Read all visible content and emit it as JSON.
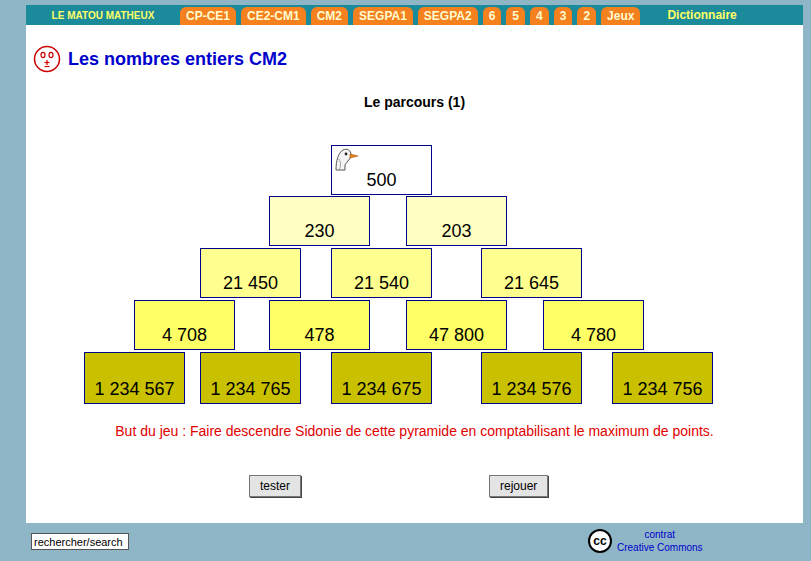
{
  "header": {
    "brand": "LE MATOU MATHEUX",
    "tabs": [
      {
        "label": "CP-CE1",
        "selected": false
      },
      {
        "label": "CE2-CM1",
        "selected": false
      },
      {
        "label": "CM2",
        "selected": false
      },
      {
        "label": "SEGPA1",
        "selected": false
      },
      {
        "label": "SEGPA2",
        "selected": false
      },
      {
        "label": "6",
        "selected": false
      },
      {
        "label": "5",
        "selected": false
      },
      {
        "label": "4",
        "selected": false
      },
      {
        "label": "3",
        "selected": false
      },
      {
        "label": "2",
        "selected": false
      },
      {
        "label": "Jeux",
        "selected": false
      }
    ],
    "dictionary": "Dictionnaire"
  },
  "page": {
    "title": "Les nombres entiers CM2",
    "subtitle": "Le parcours (1)"
  },
  "pyramid": {
    "rows": [
      [
        {
          "value": "500",
          "current": true
        }
      ],
      [
        {
          "value": "230",
          "current": false
        },
        {
          "value": "203",
          "current": false
        }
      ],
      [
        {
          "value": "21 450",
          "current": false
        },
        {
          "value": "21 540",
          "current": false
        },
        {
          "value": "21 645",
          "current": false
        }
      ],
      [
        {
          "value": "4 708",
          "current": false
        },
        {
          "value": "478",
          "current": false
        },
        {
          "value": "47 800",
          "current": false
        },
        {
          "value": "4 780",
          "current": false
        }
      ],
      [
        {
          "value": "1 234 567",
          "current": false
        },
        {
          "value": "1 234 765",
          "current": false
        },
        {
          "value": "1 234 675",
          "current": false
        },
        {
          "value": "1 234 576",
          "current": false
        },
        {
          "value": "1 234 756",
          "current": false
        }
      ]
    ]
  },
  "goal": "But du jeu : Faire descendre Sidonie de cette pyramide en comptabilisant le maximum de points.",
  "buttons": [
    "tester",
    "rejouer"
  ],
  "search": {
    "value": "rechercher/search"
  },
  "license": {
    "badge": "cc",
    "line1": "contrat",
    "line2": "Creative Commons"
  }
}
